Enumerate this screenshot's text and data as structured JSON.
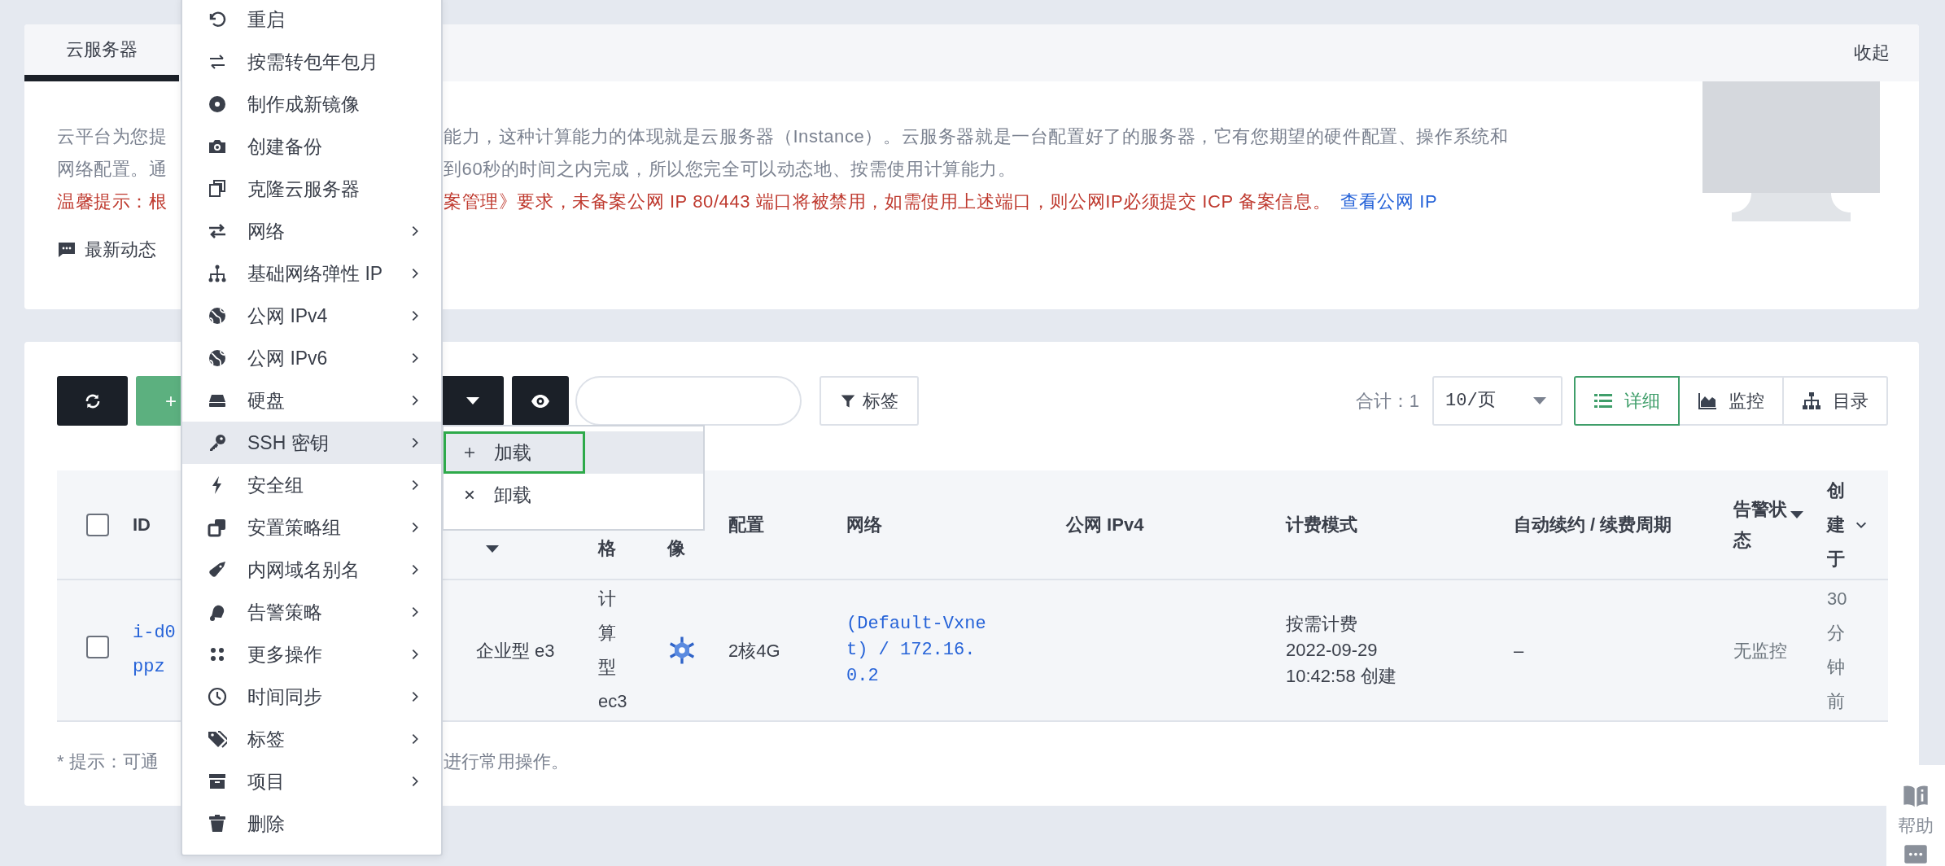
{
  "tabs": [
    {
      "label": "云服务器",
      "selected": true
    }
  ],
  "collapse_link": "收起",
  "intro": {
    "lines": [
      {
        "kind": "normal",
        "left": "云平台为您提",
        "right": "能力，这种计算能力的体现就是云服务器（Instance）。云服务器就是一台配置好了的服务器，它有您期望的硬件配置、操作系统和"
      },
      {
        "kind": "normal",
        "left": "网络配置。通",
        "right": "到60秒的时间之内完成，所以您完全可以动态地、按需使用计算能力。"
      },
      {
        "kind": "warning",
        "left": "温馨提示：根",
        "right": "案管理》要求，未备案公网 IP 80/443 端口将被禁用，如需使用上述端口，则公网IP必须提交 ICP 备案信息。",
        "link": "查看公网 IP"
      }
    ],
    "news_link": "最新动态"
  },
  "toolbar": {
    "create_button_fragment": "+",
    "tag_filter": "标签",
    "total": "合计：1",
    "page_size": "10/页",
    "views": [
      {
        "label": "详细",
        "selected": true
      },
      {
        "label": "监控",
        "selected": false
      },
      {
        "label": "目录",
        "selected": false
      }
    ]
  },
  "table": {
    "columns": [
      {
        "kind": "checkbox",
        "checked": false
      },
      {
        "kind": "text",
        "label": "ID"
      },
      {
        "kind": "caret"
      },
      {
        "kind": "text_lower",
        "label": "格"
      },
      {
        "kind": "text_lower",
        "label": "像"
      },
      {
        "kind": "text",
        "label": "配置"
      },
      {
        "kind": "text",
        "label": "网络"
      },
      {
        "kind": "text",
        "label": "公网 IPv4"
      },
      {
        "kind": "text",
        "label": "计费模式"
      },
      {
        "kind": "text",
        "label": "自动续约 / 续费周期"
      },
      {
        "kind": "sort",
        "label": "告警状态"
      },
      {
        "kind": "chevron",
        "label": "创建于"
      }
    ],
    "rows": [
      {
        "checked": false,
        "id": "i-d0\nppz",
        "instance_type": "企业型 e3",
        "class": "计算型ec3",
        "config": "2核4G",
        "network": "(Default-Vxnet) / 172.16.0.2",
        "billing_mode": "按需计费",
        "billing_time": "2022-09-29 10:42:58 创建",
        "renewal": "–",
        "alarm_status": "无监控",
        "created": "30分钟前"
      }
    ]
  },
  "footer_note": {
    "left": "* 提示：可通",
    "right": "进行常用操作。"
  },
  "context_menu": [
    {
      "label": "重启",
      "has_submenu": false,
      "selected": false
    },
    {
      "label": "按需转包年包月",
      "has_submenu": false,
      "selected": false
    },
    {
      "label": "制作成新镜像",
      "has_submenu": false,
      "selected": false
    },
    {
      "label": "创建备份",
      "has_submenu": false,
      "selected": false
    },
    {
      "label": "克隆云服务器",
      "has_submenu": false,
      "selected": false
    },
    {
      "label": "网络",
      "has_submenu": true,
      "selected": false
    },
    {
      "label": "基础网络弹性 IP",
      "has_submenu": true,
      "selected": false
    },
    {
      "label": "公网 IPv4",
      "has_submenu": true,
      "selected": false
    },
    {
      "label": "公网 IPv6",
      "has_submenu": true,
      "selected": false
    },
    {
      "label": "硬盘",
      "has_submenu": true,
      "selected": false
    },
    {
      "label": "SSH 密钥",
      "has_submenu": true,
      "selected": true
    },
    {
      "label": "安全组",
      "has_submenu": true,
      "selected": false
    },
    {
      "label": "安置策略组",
      "has_submenu": true,
      "selected": false
    },
    {
      "label": "内网域名别名",
      "has_submenu": true,
      "selected": false
    },
    {
      "label": "告警策略",
      "has_submenu": true,
      "selected": false
    },
    {
      "label": "更多操作",
      "has_submenu": true,
      "selected": false
    },
    {
      "label": "时间同步",
      "has_submenu": true,
      "selected": false
    },
    {
      "label": "标签",
      "has_submenu": true,
      "selected": false
    },
    {
      "label": "项目",
      "has_submenu": true,
      "selected": false
    },
    {
      "label": "删除",
      "has_submenu": false,
      "selected": false
    }
  ],
  "submenu": [
    {
      "label": "加载",
      "selected": true,
      "outlined": true
    },
    {
      "label": "卸载",
      "selected": false,
      "outlined": false
    }
  ],
  "help": {
    "label": "帮助"
  }
}
